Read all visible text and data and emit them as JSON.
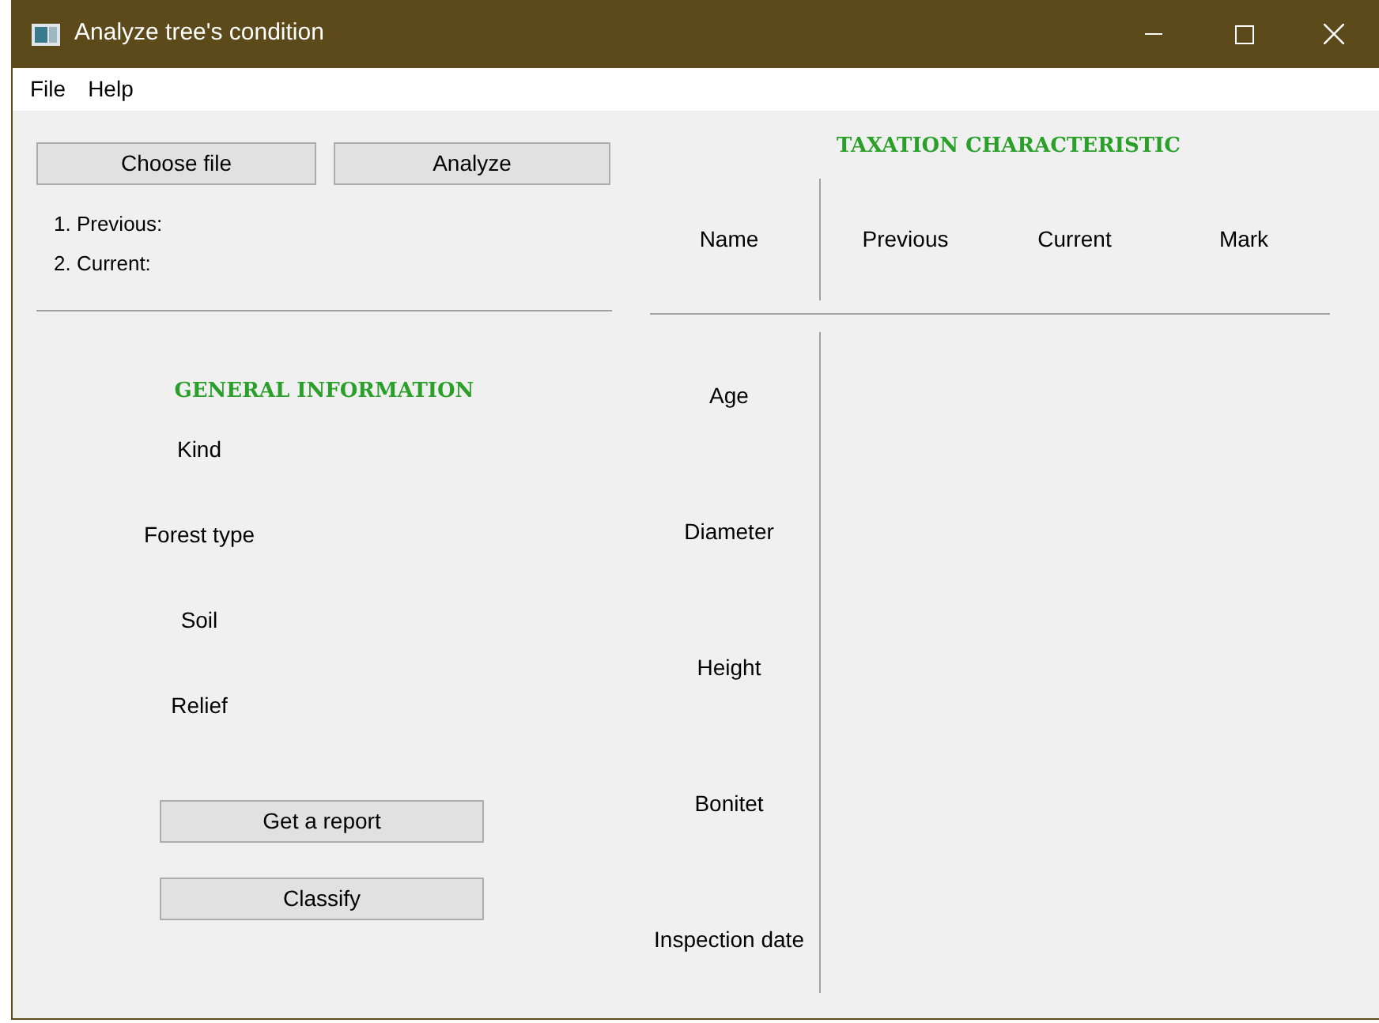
{
  "window": {
    "title": "Analyze tree's condition"
  },
  "menu": [
    "File",
    "Help"
  ],
  "file_buttons": [
    "Choose file",
    "Analyze"
  ],
  "files": [
    "1. Previous:",
    "2. Current:"
  ],
  "general": {
    "title": "GENERAL INFORMATION",
    "fields": [
      "Kind",
      "Forest type",
      "Soil",
      "Relief"
    ]
  },
  "actions": [
    "Get a report",
    "Classify"
  ],
  "taxation": {
    "title": "TAXATION CHARACTERISTIC",
    "name_header": "Name",
    "columns": [
      "Previous",
      "Current",
      "Mark"
    ],
    "rows": [
      "Age",
      "Diameter",
      "Height",
      "Bonitet",
      "Inspection date"
    ]
  }
}
